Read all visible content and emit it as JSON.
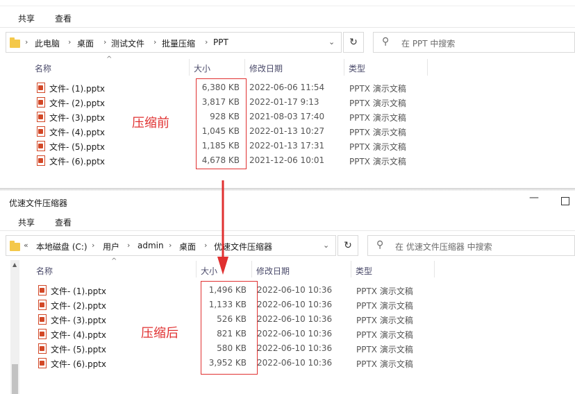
{
  "top": {
    "ribbon": {
      "share": "共享",
      "view": "查看"
    },
    "breadcrumb": [
      "此电脑",
      "桌面",
      "测试文件",
      "批量压缩",
      "PPT"
    ],
    "search_placeholder": "在 PPT 中搜索",
    "columns": {
      "name": "名称",
      "size": "大小",
      "date": "修改日期",
      "type": "类型"
    },
    "files": [
      {
        "name": "文件- (1).pptx",
        "size": "6,380 KB",
        "date": "2022-06-06 11:54",
        "type": "PPTX 演示文稿"
      },
      {
        "name": "文件- (2).pptx",
        "size": "3,817 KB",
        "date": "2022-01-17 9:13",
        "type": "PPTX 演示文稿"
      },
      {
        "name": "文件- (3).pptx",
        "size": "928 KB",
        "date": "2021-08-03 17:40",
        "type": "PPTX 演示文稿"
      },
      {
        "name": "文件- (4).pptx",
        "size": "1,045 KB",
        "date": "2022-01-13 10:27",
        "type": "PPTX 演示文稿"
      },
      {
        "name": "文件- (5).pptx",
        "size": "1,185 KB",
        "date": "2022-01-13 17:31",
        "type": "PPTX 演示文稿"
      },
      {
        "name": "文件- (6).pptx",
        "size": "4,678 KB",
        "date": "2021-12-06 10:01",
        "type": "PPTX 演示文稿"
      }
    ],
    "annotation": "压缩前"
  },
  "bottom": {
    "window_title": "优速文件压缩器",
    "ribbon": {
      "share": "共享",
      "view": "查看"
    },
    "breadcrumb_prefix": "«",
    "breadcrumb": [
      "本地磁盘 (C:)",
      "用户",
      "admin",
      "桌面",
      "优速文件压缩器"
    ],
    "search_placeholder": "在 优速文件压缩器 中搜索",
    "columns": {
      "name": "名称",
      "size": "大小",
      "date": "修改日期",
      "type": "类型"
    },
    "files": [
      {
        "name": "文件- (1).pptx",
        "size": "1,496 KB",
        "date": "2022-06-10 10:36",
        "type": "PPTX 演示文稿"
      },
      {
        "name": "文件- (2).pptx",
        "size": "1,133 KB",
        "date": "2022-06-10 10:36",
        "type": "PPTX 演示文稿"
      },
      {
        "name": "文件- (3).pptx",
        "size": "526 KB",
        "date": "2022-06-10 10:36",
        "type": "PPTX 演示文稿"
      },
      {
        "name": "文件- (4).pptx",
        "size": "821 KB",
        "date": "2022-06-10 10:36",
        "type": "PPTX 演示文稿"
      },
      {
        "name": "文件- (5).pptx",
        "size": "580 KB",
        "date": "2022-06-10 10:36",
        "type": "PPTX 演示文稿"
      },
      {
        "name": "文件- (6).pptx",
        "size": "3,952 KB",
        "date": "2022-06-10 10:36",
        "type": "PPTX 演示文稿"
      }
    ],
    "annotation": "压缩后"
  },
  "colors": {
    "accent_red": "#e03030",
    "pptx_orange": "#d24726",
    "folder_yellow": "#f4c84a"
  }
}
